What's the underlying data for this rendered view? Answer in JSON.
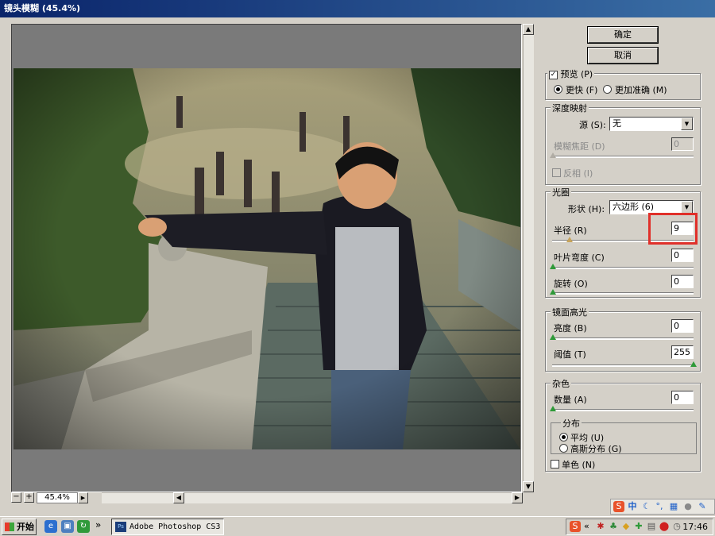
{
  "window": {
    "title": "镜头模糊 (45.4%)"
  },
  "buttons": {
    "ok": "确定",
    "cancel": "取消"
  },
  "preview": {
    "checkbox_label": "预览 (P)",
    "checked": true,
    "fast_label": "更快 (F)",
    "accurate_label": "更加准确 (M)"
  },
  "depth_map": {
    "title": "深度映射",
    "source_label": "源 (S):",
    "source_value": "无",
    "focal_label": "模糊焦距 (D)",
    "focal_value": "0",
    "invert_label": "反相 (I)"
  },
  "iris": {
    "title": "光圈",
    "shape_label": "形状 (H):",
    "shape_value": "六边形 (6)",
    "radius_label": "半径 (R)",
    "radius_value": "9",
    "curvature_label": "叶片弯度 (C)",
    "curvature_value": "0",
    "rotation_label": "旋转 (O)",
    "rotation_value": "0"
  },
  "specular": {
    "title": "镜面高光",
    "brightness_label": "亮度 (B)",
    "brightness_value": "0",
    "threshold_label": "阈值 (T)",
    "threshold_value": "255"
  },
  "noise": {
    "title": "杂色",
    "amount_label": "数量 (A)",
    "amount_value": "0",
    "distribution_title": "分布",
    "uniform_label": "平均 (U)",
    "gaussian_label": "高斯分布 (G)",
    "mono_label": "单色 (N)"
  },
  "zoom": {
    "value": "45.4%"
  },
  "taskbar": {
    "start_label": "开始",
    "task_label": "Adobe Photoshop CS3",
    "clock": "17:46",
    "chevron": "»",
    "tray_chevron": "«"
  },
  "ime": {
    "lang": "中"
  }
}
